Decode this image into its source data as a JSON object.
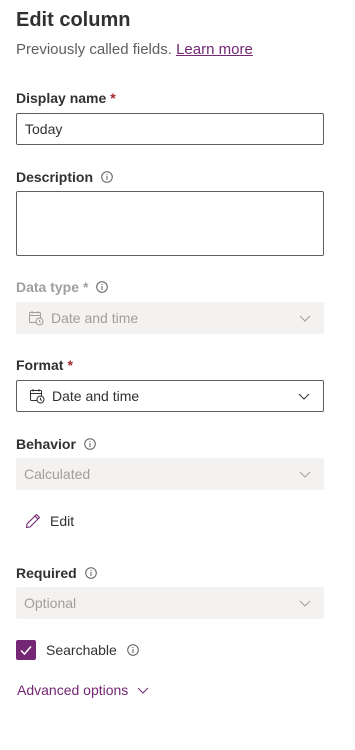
{
  "header": {
    "title": "Edit column",
    "subtitle": "Previously called fields.",
    "learn_more": "Learn more"
  },
  "display_name": {
    "label": "Display name",
    "required_mark": "*",
    "value": "Today"
  },
  "description": {
    "label": "Description",
    "value": ""
  },
  "data_type": {
    "label": "Data type",
    "required_mark": "*",
    "value": "Date and time",
    "icon": "calendar-clock-icon"
  },
  "format": {
    "label": "Format",
    "required_mark": "*",
    "value": "Date and time",
    "icon": "calendar-clock-icon"
  },
  "behavior": {
    "label": "Behavior",
    "value": "Calculated",
    "edit_label": "Edit"
  },
  "required": {
    "label": "Required",
    "value": "Optional"
  },
  "searchable": {
    "label": "Searchable",
    "checked": true
  },
  "advanced": {
    "label": "Advanced options"
  },
  "colors": {
    "accent": "#742774",
    "required": "#a4262c",
    "disabled_bg": "#f3f2f1",
    "disabled_text": "#a19f9d"
  }
}
